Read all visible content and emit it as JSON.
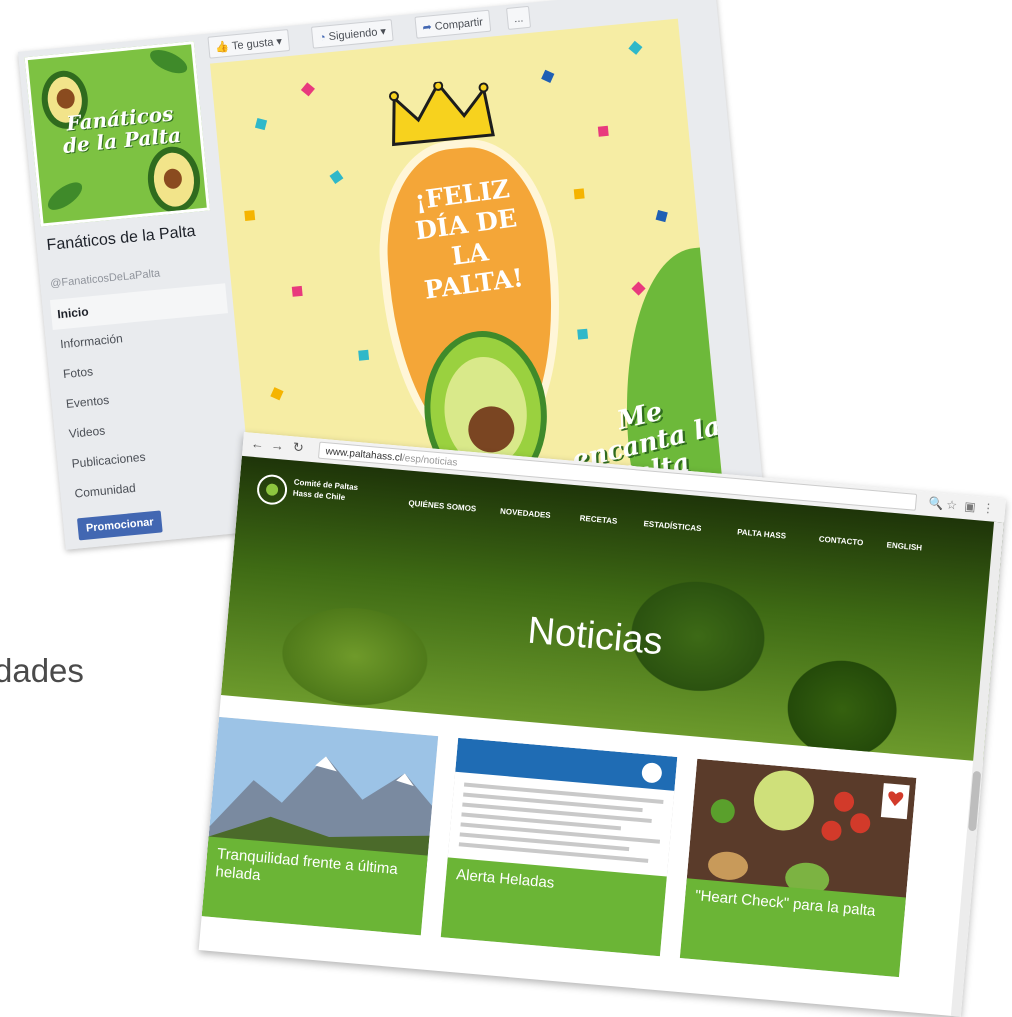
{
  "background": {
    "partial_word": "dades"
  },
  "facebook": {
    "profile_title": "Fanáticos de la Palta",
    "page_name": "Fanáticos de la Palta",
    "handle": "@FanaticosDeLaPalta",
    "nav": [
      "Inicio",
      "Información",
      "Fotos",
      "Eventos",
      "Videos",
      "Publicaciones",
      "Comunidad"
    ],
    "promote_label": "Promocionar",
    "actions": {
      "liked": "Te gusta",
      "following": "Siguiendo",
      "share": "Compartir",
      "more": "..."
    },
    "cover": {
      "headline": "¡FELIZ DÍA DE LA PALTA!",
      "slogan": "Me encanta la Palta"
    }
  },
  "website": {
    "url_domain": "www.paltahass.cl",
    "url_path": "/esp/noticias",
    "logo_line1": "Comité de Paltas",
    "logo_line2": "Hass de Chile",
    "menu": [
      "QUIÉNES SOMOS",
      "NOVEDADES",
      "RECETAS",
      "ESTADÍSTICAS",
      "PALTA HASS",
      "CONTACTO",
      "ENGLISH"
    ],
    "page_title": "Noticias",
    "cards": [
      {
        "caption": "Tranquilidad frente a última helada",
        "meta": ""
      },
      {
        "caption": "Alerta Heladas",
        "meta": ""
      },
      {
        "caption": "\"Heart Check\" para la palta",
        "meta": ""
      }
    ]
  },
  "colors": {
    "facebook_blue": "#4267b2",
    "site_green": "#6bb536",
    "cover_yellow": "#f6eda4"
  }
}
